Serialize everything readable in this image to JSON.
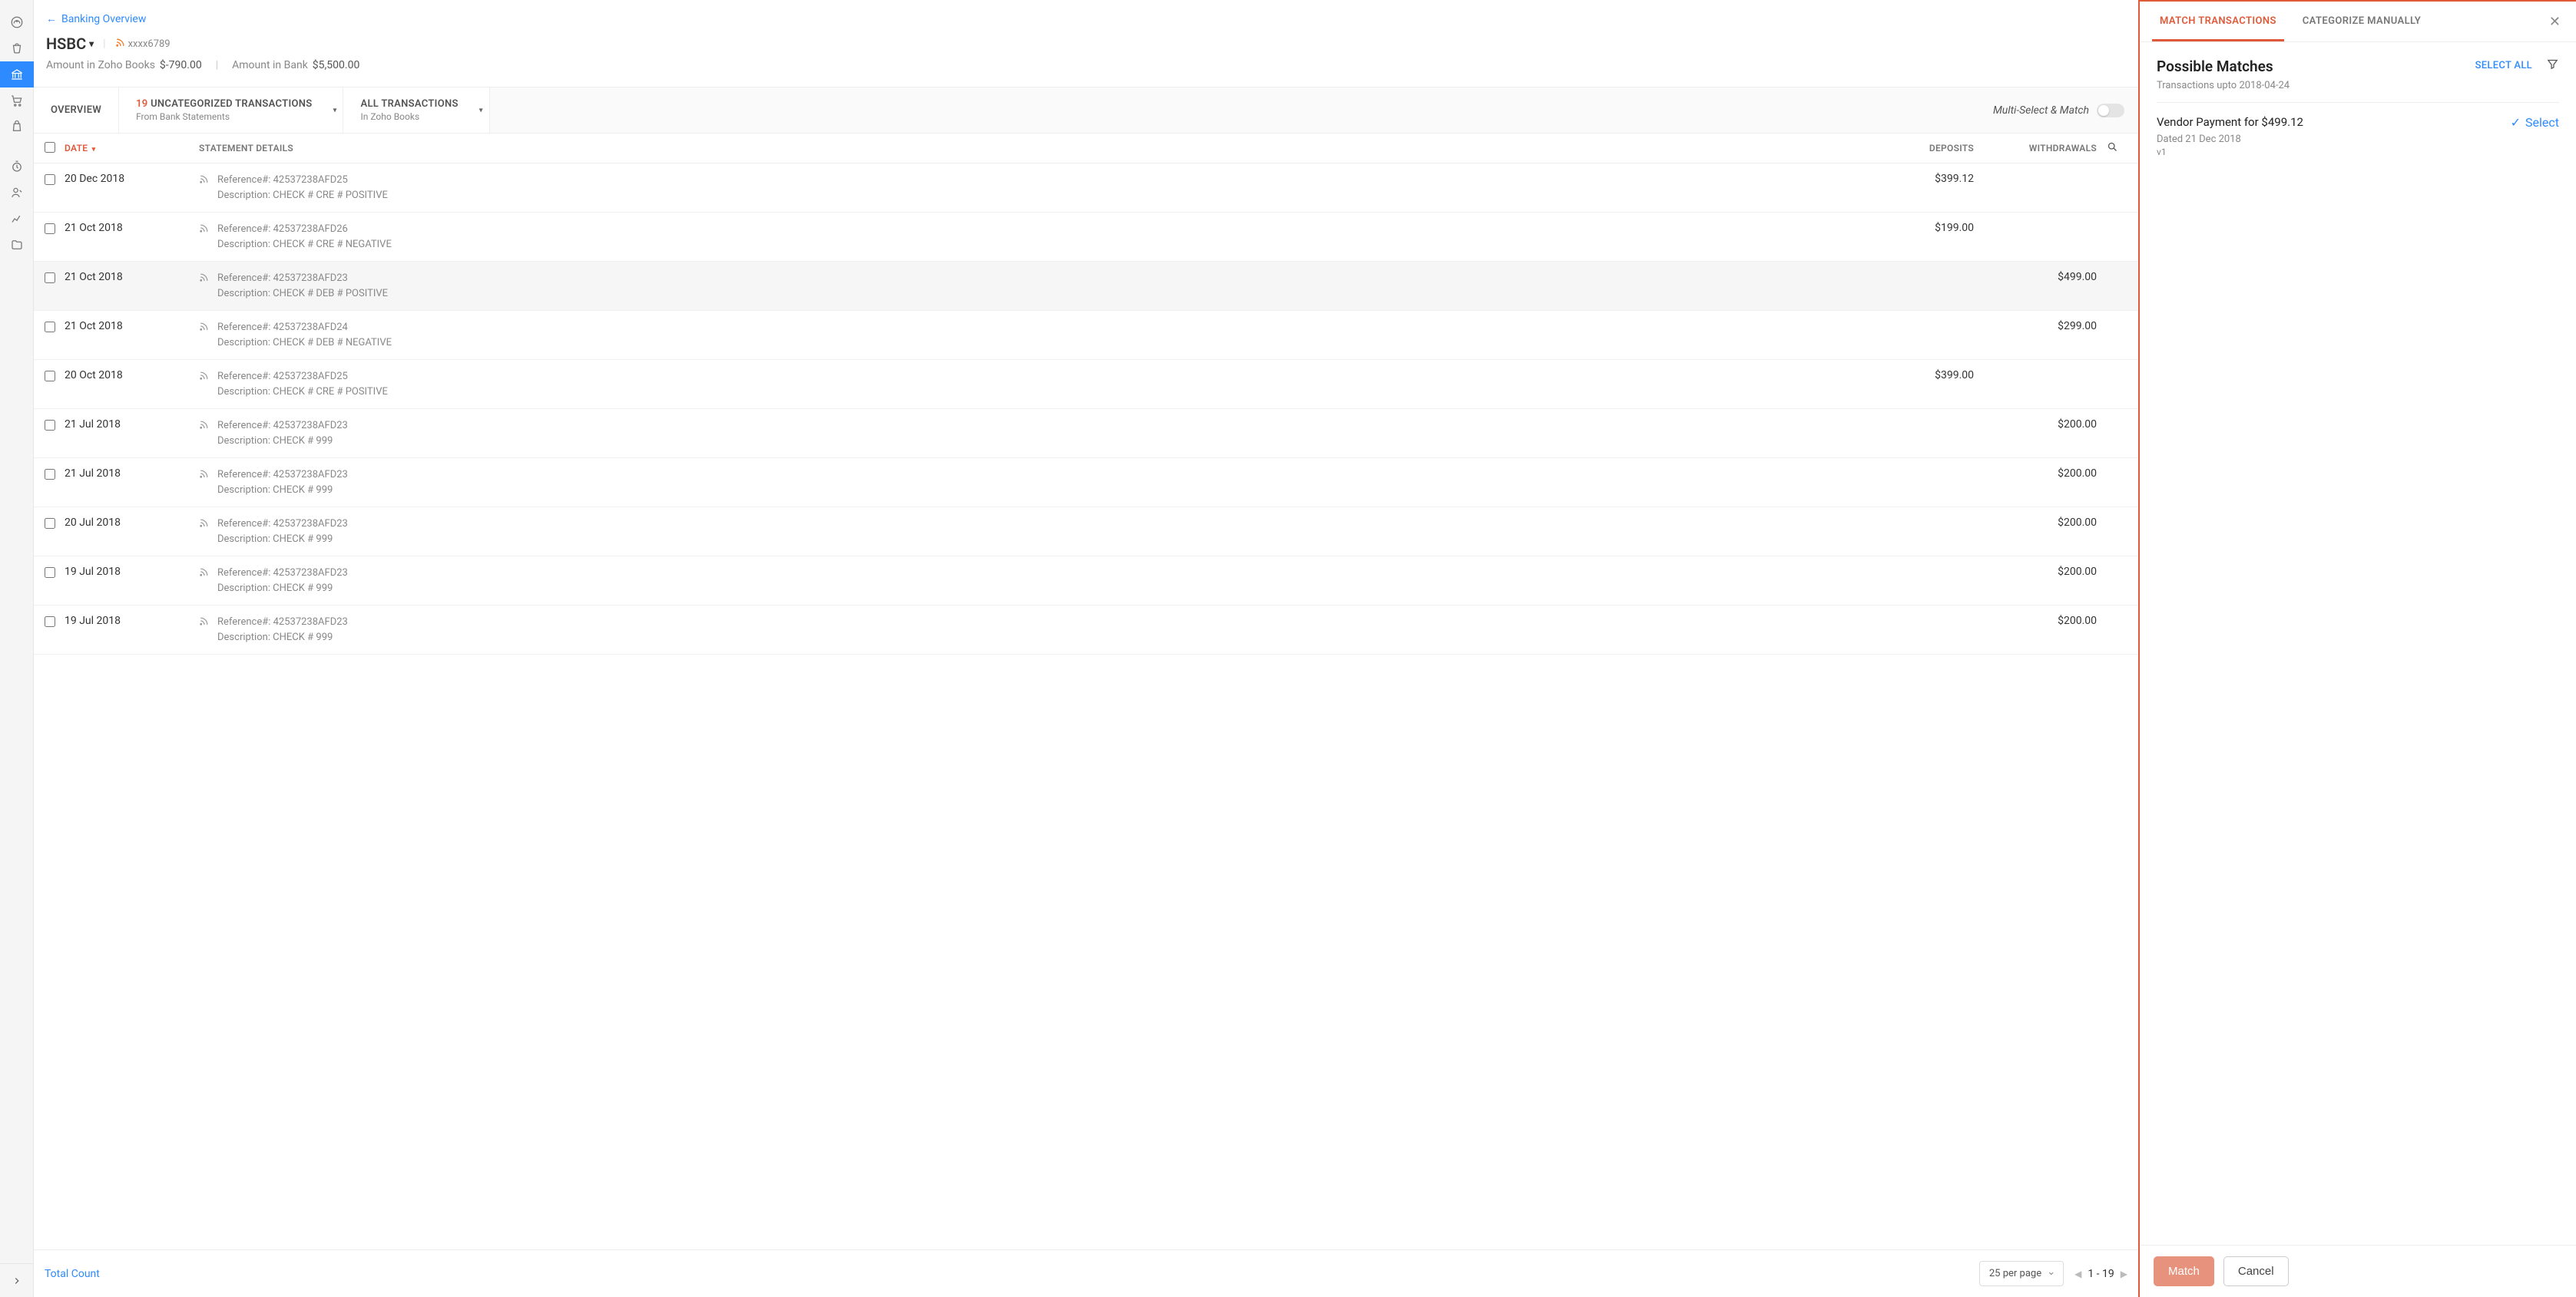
{
  "breadcrumb": {
    "back_label": "Banking Overview"
  },
  "account": {
    "name": "HSBC",
    "feed_mask": "xxxx6789",
    "zoho_label": "Amount in Zoho Books",
    "zoho_amount": "$-790.00",
    "bank_label": "Amount in Bank",
    "bank_amount": "$5,500.00"
  },
  "tabs": {
    "overview": "OVERVIEW",
    "uncat_count": "19",
    "uncat_label": "UNCATEGORIZED TRANSACTIONS",
    "uncat_sub": "From Bank Statements",
    "all_label": "ALL TRANSACTIONS",
    "all_sub": "In Zoho Books",
    "multi_match": "Multi-Select & Match"
  },
  "table": {
    "headers": {
      "date": "DATE",
      "details": "STATEMENT DETAILS",
      "deposits": "DEPOSITS",
      "withdrawals": "WITHDRAWALS"
    },
    "rows": [
      {
        "date": "20 Dec 2018",
        "ref": "Reference#: 42537238AFD25",
        "desc": "Description: CHECK # CRE # POSITIVE",
        "deposit": "$399.12",
        "withdrawal": "",
        "selected": false
      },
      {
        "date": "21 Oct 2018",
        "ref": "Reference#: 42537238AFD26",
        "desc": "Description: CHECK # CRE # NEGATIVE",
        "deposit": "$199.00",
        "withdrawal": "",
        "selected": false
      },
      {
        "date": "21 Oct 2018",
        "ref": "Reference#: 42537238AFD23",
        "desc": "Description: CHECK # DEB # POSITIVE",
        "deposit": "",
        "withdrawal": "$499.00",
        "selected": true
      },
      {
        "date": "21 Oct 2018",
        "ref": "Reference#: 42537238AFD24",
        "desc": "Description: CHECK # DEB # NEGATIVE",
        "deposit": "",
        "withdrawal": "$299.00",
        "selected": false
      },
      {
        "date": "20 Oct 2018",
        "ref": "Reference#: 42537238AFD25",
        "desc": "Description: CHECK # CRE # POSITIVE",
        "deposit": "$399.00",
        "withdrawal": "",
        "selected": false
      },
      {
        "date": "21 Jul 2018",
        "ref": "Reference#: 42537238AFD23",
        "desc": "Description: CHECK # 999",
        "deposit": "",
        "withdrawal": "$200.00",
        "selected": false
      },
      {
        "date": "21 Jul 2018",
        "ref": "Reference#: 42537238AFD23",
        "desc": "Description: CHECK # 999",
        "deposit": "",
        "withdrawal": "$200.00",
        "selected": false
      },
      {
        "date": "20 Jul 2018",
        "ref": "Reference#: 42537238AFD23",
        "desc": "Description: CHECK # 999",
        "deposit": "",
        "withdrawal": "$200.00",
        "selected": false
      },
      {
        "date": "19 Jul 2018",
        "ref": "Reference#: 42537238AFD23",
        "desc": "Description: CHECK # 999",
        "deposit": "",
        "withdrawal": "$200.00",
        "selected": false
      },
      {
        "date": "19 Jul 2018",
        "ref": "Reference#: 42537238AFD23",
        "desc": "Description: CHECK # 999",
        "deposit": "",
        "withdrawal": "$200.00",
        "selected": false
      }
    ]
  },
  "footer": {
    "total_count": "Total Count",
    "per_page": "25 per page",
    "range": "1 - 19"
  },
  "panel": {
    "tab_match": "MATCH TRANSACTIONS",
    "tab_categorize": "CATEGORIZE MANUALLY",
    "pm_title": "Possible Matches",
    "pm_sub": "Transactions upto 2018-04-24",
    "select_all": "SELECT ALL",
    "match": {
      "title": "Vendor Payment for $499.12",
      "dated": "Dated 21 Dec 2018",
      "vendor": "v1",
      "select": "Select"
    },
    "btn_match": "Match",
    "btn_cancel": "Cancel"
  }
}
